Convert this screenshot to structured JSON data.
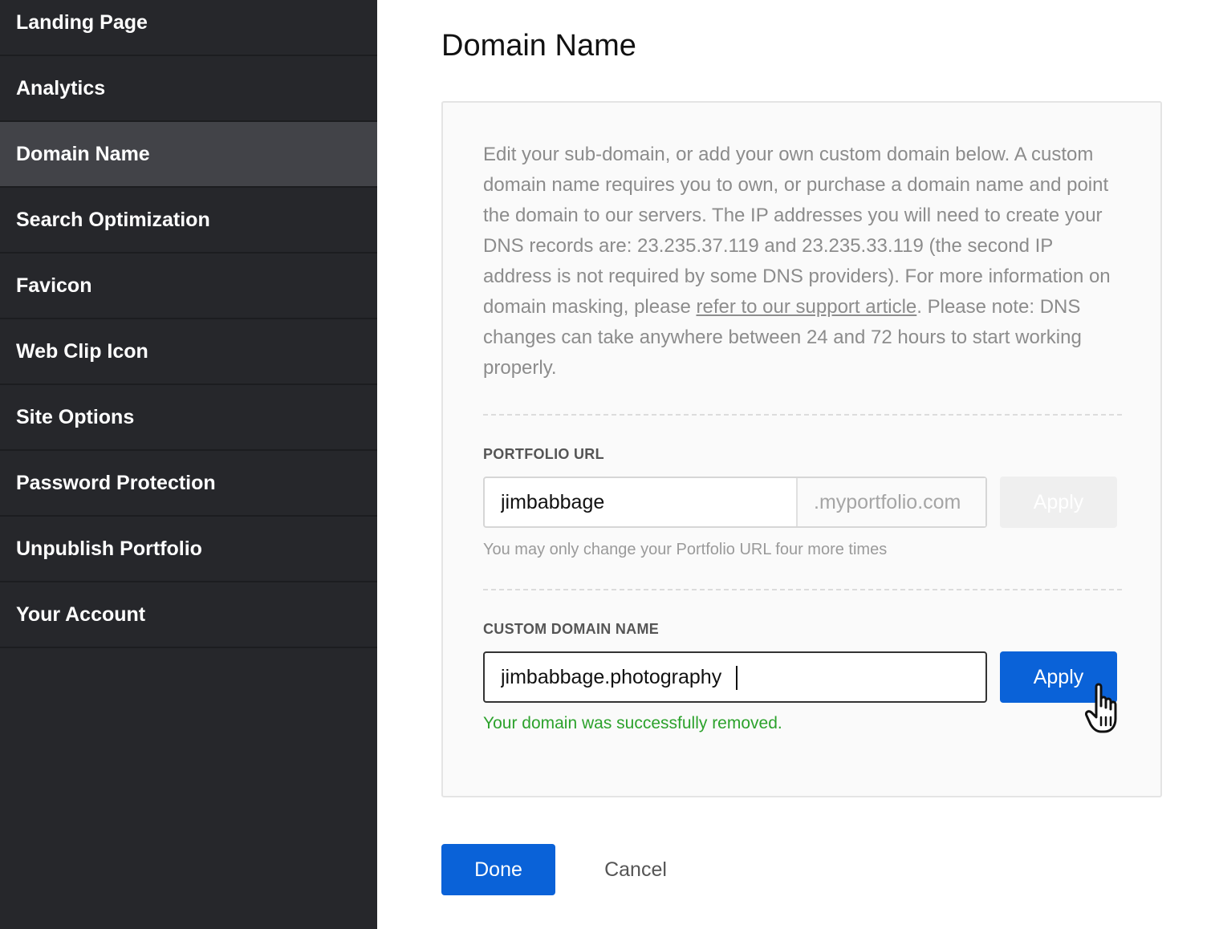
{
  "sidebar": {
    "items": [
      {
        "label": "Landing Page"
      },
      {
        "label": "Analytics"
      },
      {
        "label": "Domain Name",
        "active": true
      },
      {
        "label": "Search Optimization"
      },
      {
        "label": "Favicon"
      },
      {
        "label": "Web Clip Icon"
      },
      {
        "label": "Site Options"
      },
      {
        "label": "Password Protection"
      },
      {
        "label": "Unpublish Portfolio"
      },
      {
        "label": "Your Account"
      }
    ]
  },
  "main": {
    "title": "Domain Name",
    "intro": {
      "text_before_link": "Edit your sub-domain, or add your own custom domain below. A custom domain name requires you to own, or purchase a domain name and point the domain to our servers. The IP addresses you will need to create your DNS records are: 23.235.37.119 and 23.235.33.119 (the second IP address is not required by some DNS providers). For more information on domain masking, please ",
      "link_text": "refer to our support article",
      "text_after_link": ". Please note: DNS changes can take anywhere between 24 and 72 hours to start working properly."
    },
    "portfolio_url": {
      "label": "PORTFOLIO URL",
      "value": "jimbabbage",
      "suffix": ".myportfolio.com",
      "apply_label": "Apply",
      "hint": "You may only change your Portfolio URL four more times"
    },
    "custom_domain": {
      "label": "CUSTOM DOMAIN NAME",
      "value": "jimbabbage.photography",
      "apply_label": "Apply",
      "success_message": "Your domain was successfully removed."
    },
    "done_label": "Done",
    "cancel_label": "Cancel"
  },
  "colors": {
    "sidebar_bg": "#26272b",
    "sidebar_active": "#424348",
    "primary": "#0a62d8",
    "success": "#2ca22c"
  },
  "icons": {
    "cursor": "hand-pointer-icon"
  }
}
